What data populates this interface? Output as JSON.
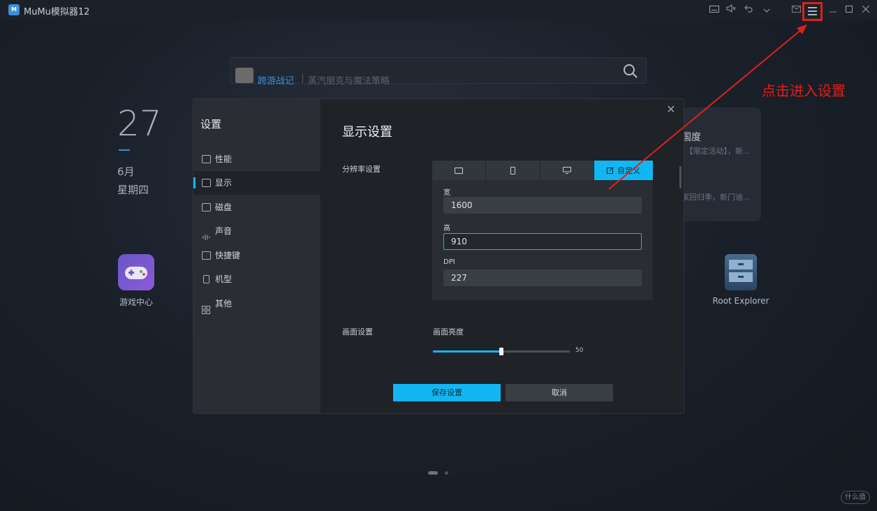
{
  "window": {
    "title": "MuMu模拟器12",
    "logo_text": "M",
    "accent_color": "#12b6f2",
    "annotation_color": "#e0201a"
  },
  "titlebar_icons": [
    "keyboard-icon",
    "mute-icon",
    "back-icon",
    "dropdown-icon",
    "mail-icon",
    "menu-icon",
    "minimize-icon",
    "maximize-icon",
    "close-icon"
  ],
  "search": {
    "tag": "跨游战记",
    "hint": "蒸汽朋克与魔法策略"
  },
  "date": {
    "day": "27",
    "month": "6月",
    "weekday": "星期四"
  },
  "desktop_apps": [
    {
      "label": "游戏中心"
    },
    {
      "label": "Root Explorer"
    }
  ],
  "news_card": {
    "title": "国度",
    "line1": "〕【限定活动】，新...",
    "line2": "家回归季，新门迪..."
  },
  "annotation": {
    "text": "点击进入设置"
  },
  "watermark": "什么值",
  "settings": {
    "title": "设置",
    "nav": [
      {
        "label": "性能",
        "icon": "performance-icon"
      },
      {
        "label": "显示",
        "icon": "display-icon",
        "active": true
      },
      {
        "label": "磁盘",
        "icon": "disk-icon"
      },
      {
        "label": "声音",
        "icon": "sound-icon"
      },
      {
        "label": "快捷键",
        "icon": "keyboard-icon"
      },
      {
        "label": "机型",
        "icon": "phone-icon"
      },
      {
        "label": "其他",
        "icon": "grid-icon"
      }
    ],
    "panel_title": "显示设置",
    "resolution": {
      "label": "分辨率设置",
      "tabs": [
        {
          "icon": "tablet-icon",
          "label": ""
        },
        {
          "icon": "phone-icon",
          "label": ""
        },
        {
          "icon": "monitor-icon",
          "label": ""
        },
        {
          "icon": "edit-icon",
          "label": "自定义",
          "active": true
        }
      ],
      "width_label": "宽",
      "width_value": "1600",
      "height_label": "高",
      "height_value": "910",
      "dpi_label": "DPI",
      "dpi_value": "227"
    },
    "screen": {
      "label": "画面设置",
      "brightness_label": "画面亮度",
      "brightness_value": "50",
      "brightness_fraction": 0.5
    },
    "buttons": {
      "save": "保存设置",
      "cancel": "取消"
    }
  }
}
